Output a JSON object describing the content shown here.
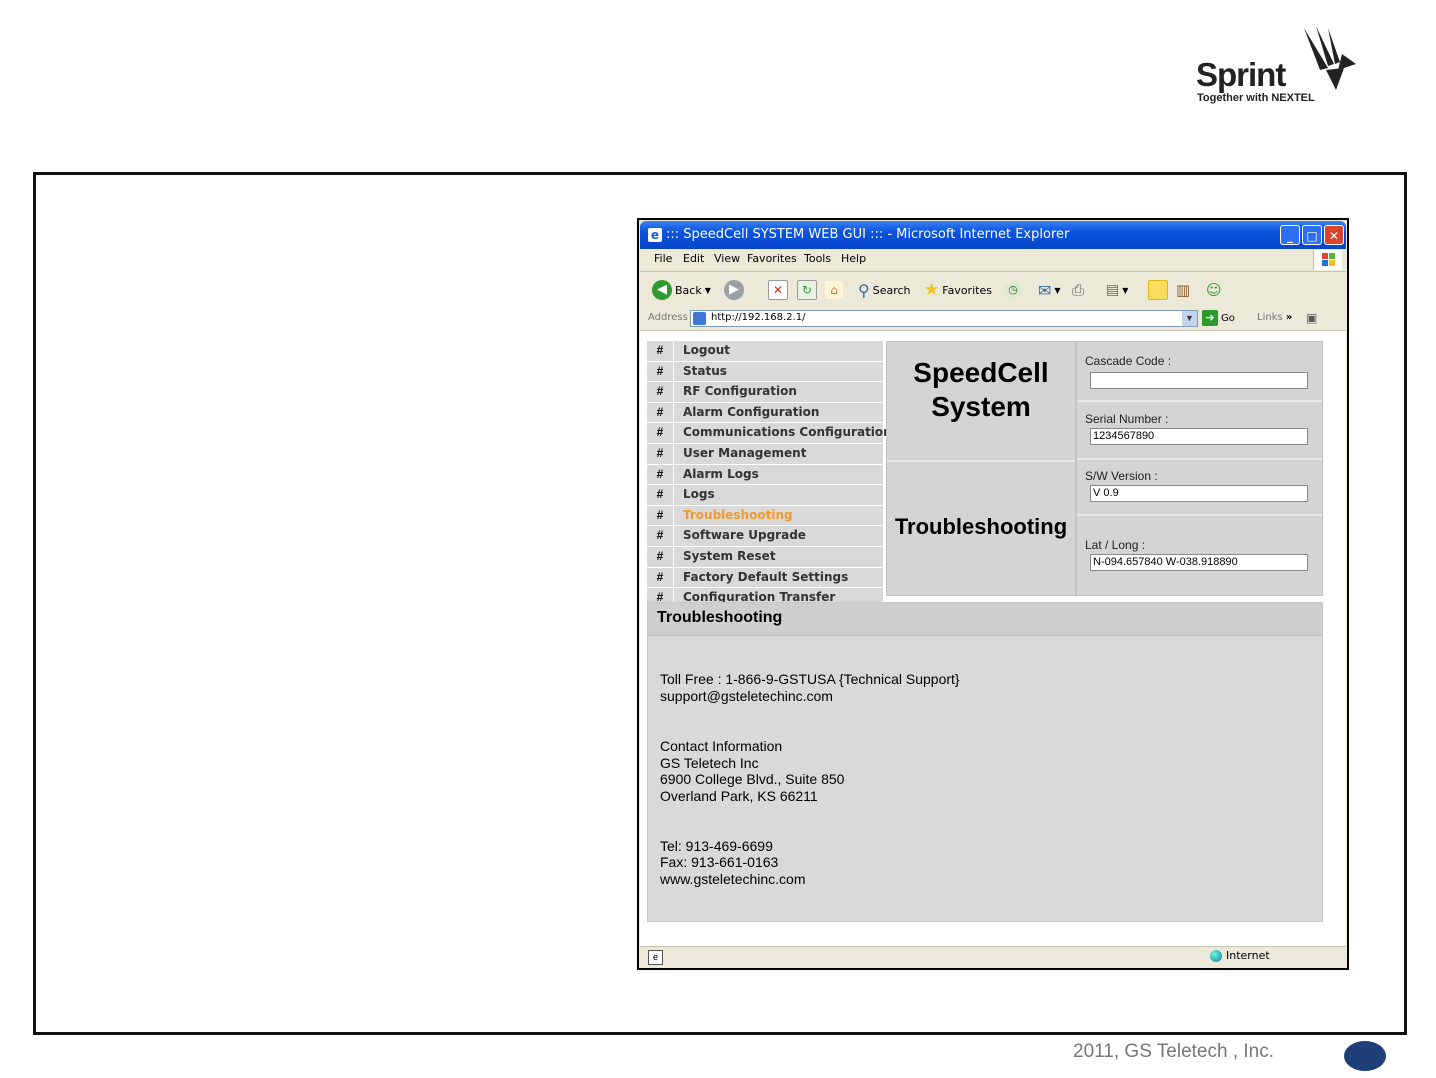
{
  "logo": {
    "word": "Sprint",
    "tagline": "Together with NEXTEL"
  },
  "browser": {
    "title": "::: SpeedCell SYSTEM WEB GUI ::: - Microsoft Internet Explorer",
    "menu": [
      "File",
      "Edit",
      "View",
      "Favorites",
      "Tools",
      "Help"
    ],
    "toolbar": {
      "back": "Back",
      "search": "Search",
      "favorites": "Favorites"
    },
    "address_label": "Address",
    "url": "http://192.168.2.1/",
    "go": "Go",
    "links": "Links",
    "status_zone": "Internet"
  },
  "nav": {
    "hash": "#",
    "items": [
      "Logout",
      "Status",
      "RF Configuration",
      "Alarm Configuration",
      "Communications Configuration",
      "User Management",
      "Alarm Logs",
      "Logs",
      "Troubleshooting",
      "Software Upgrade",
      "System Reset",
      "Factory Default Settings",
      "Configuration Transfer"
    ],
    "active_index": 8
  },
  "header": {
    "title_line1": "SpeedCell",
    "title_line2": "System",
    "subtitle": "Troubleshooting"
  },
  "fields": {
    "cascade_label": "Cascade Code :",
    "cascade_value": "",
    "serial_label": "Serial Number :",
    "serial_value": "1234567890",
    "sw_label": "S/W Version :",
    "sw_value": "V 0.9",
    "latlong_label": "Lat / Long :",
    "latlong_value": "N-094.657840 W-038.918890"
  },
  "troubleshooting": {
    "heading": "Troubleshooting",
    "toll_free": "Toll Free : 1-866-9-GSTUSA {Technical Support}",
    "email": "support@gsteletechinc.com",
    "contact_title": "Contact Information",
    "company": "GS Teletech Inc",
    "address1": "6900 College Blvd., Suite 850",
    "address2": "Overland Park, KS 66211",
    "tel": "Tel: 913-469-6699",
    "fax": "Fax: 913-661-0163",
    "web": "www.gsteletechinc.com"
  },
  "footer": {
    "text": "2011, GS Teletech , Inc."
  },
  "colors": {
    "active_nav": "#f39a29",
    "title_bar": "#0a53de",
    "page_oval": "#1f3f7a"
  }
}
